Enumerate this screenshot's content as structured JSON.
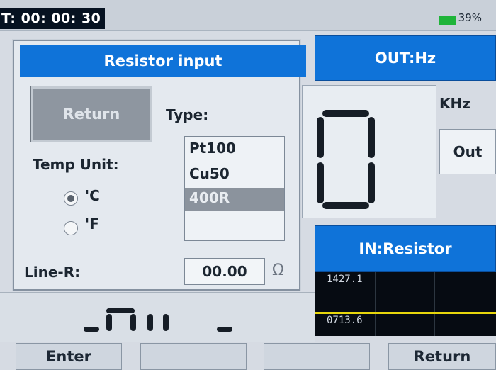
{
  "status": {
    "timer": "T: 00: 00: 30",
    "battery": "39%",
    "battery_level": 0.39
  },
  "out_panel": {
    "header": "OUT:Hz",
    "digit": "0",
    "unit": "KHz",
    "out_button": "Out"
  },
  "in_panel": {
    "header": "IN:Resistor",
    "y_labels": [
      "1427.1",
      "0713.6"
    ]
  },
  "dialog": {
    "title": "Resistor input",
    "return_button": "Return",
    "type_label": "Type:",
    "types": [
      "Pt100",
      "Cu50",
      "400R"
    ],
    "selected_type": "400R",
    "temp_unit_label": "Temp Unit:",
    "units": [
      "'C",
      "'F"
    ],
    "selected_unit": "'C",
    "line_r_label": "Line-R:",
    "line_r_value": "00.00",
    "line_r_unit": "Ω"
  },
  "bottom_buttons": {
    "enter": "Enter",
    "btn2": "",
    "btn3": "",
    "return": "Return"
  },
  "colors": {
    "header_blue": "#0f73d9",
    "graph_bg": "#060b12",
    "trace": "#e7d60c",
    "battery": "#1fb43a"
  }
}
